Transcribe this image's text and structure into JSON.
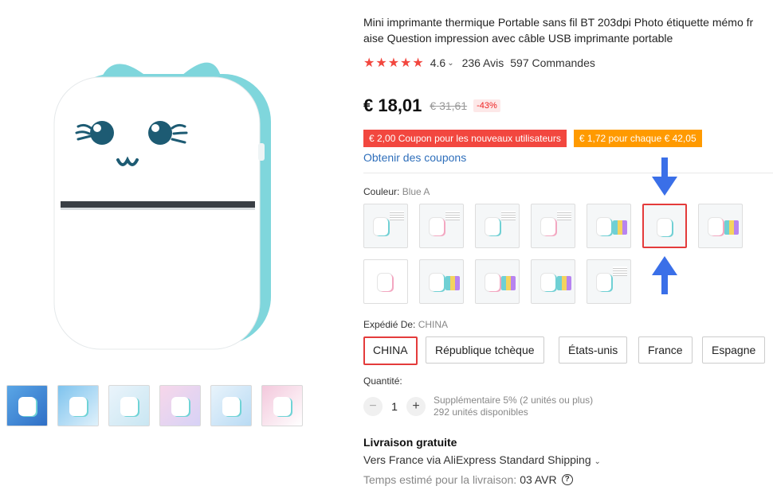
{
  "product": {
    "title_line1": "Mini imprimante thermique Portable sans fil BT 203dpi Photo étiquette mémo fr",
    "title_line2": "aise Question impression avec câble USB imprimante portable",
    "stars": "★★★★★",
    "rating": "4.6",
    "reviews": "236 Avis",
    "orders": "597 Commandes"
  },
  "price": {
    "current": "€ 18,01",
    "original": "€ 31,61",
    "discount": "-43%"
  },
  "coupons": [
    {
      "text": "€ 2,00 Coupon pour les nouveaux utilisateurs",
      "color": "#f2473f"
    },
    {
      "text": "€ 1,72 pour chaque € 42,05",
      "color": "#ff9a00"
    }
  ],
  "get_coupons": "Obtenir des coupons",
  "color": {
    "label": "Couleur:",
    "selected": "Blue A",
    "options_row1": [
      "blue-paper",
      "pink-paper",
      "blue-paper-box",
      "pink-paper-box",
      "blue-rolls",
      "blue-a",
      "pink-rolls"
    ],
    "options_row2": [
      "pink-b",
      "blue-rolls-2",
      "pink-rolls-2",
      "blue-rolls-3",
      "blue-single"
    ]
  },
  "shipping_from": {
    "label": "Expédié De:",
    "selected": "CHINA",
    "options": [
      "CHINA",
      "République tchèque",
      "États-unis",
      "France",
      "Espagne"
    ]
  },
  "quantity": {
    "label": "Quantité:",
    "value": "1",
    "extra": "Supplémentaire 5% (2 unités ou plus)",
    "available": "292 unités disponibles"
  },
  "delivery": {
    "title": "Livraison gratuite",
    "via": "Vers France via AliExpress Standard Shipping",
    "eta_label": "Temps estimé pour la livraison:",
    "eta_date": "03 AVR"
  },
  "colors": {
    "accent_red": "#e43b3b",
    "link_blue": "#2f6fbb",
    "arrow_blue": "#3a6fe8"
  }
}
